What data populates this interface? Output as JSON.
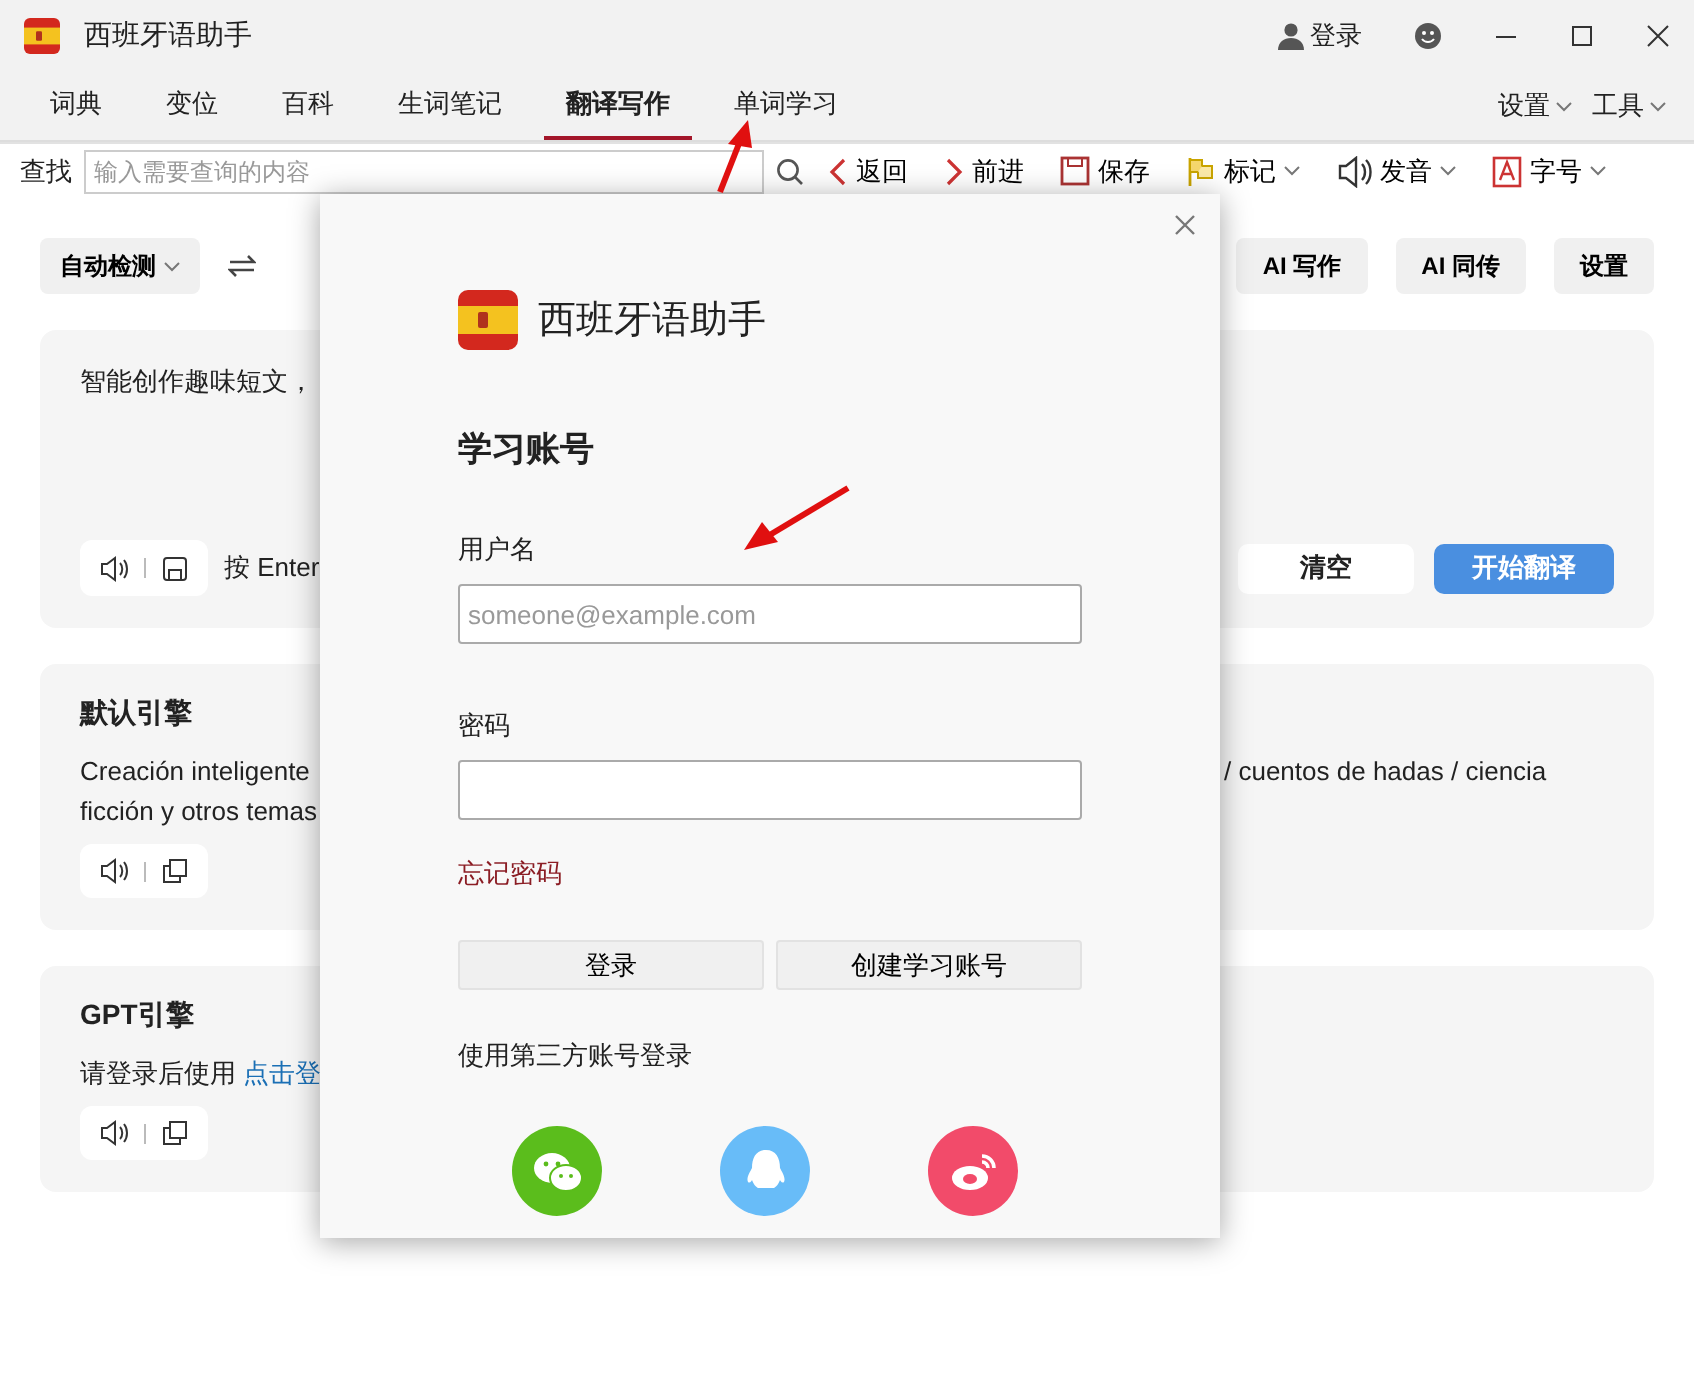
{
  "app": {
    "title": "西班牙语助手",
    "login": "登录"
  },
  "tabs": [
    {
      "label": "词典",
      "selected": false
    },
    {
      "label": "变位",
      "selected": false
    },
    {
      "label": "百科",
      "selected": false
    },
    {
      "label": "生词笔记",
      "selected": false
    },
    {
      "label": "翻译写作",
      "selected": true
    },
    {
      "label": "单词学习",
      "selected": false
    }
  ],
  "menus": [
    "设置",
    "工具"
  ],
  "search": {
    "label": "查找",
    "placeholder": "输入需要查询的内容"
  },
  "toolbar": [
    {
      "label": "返回",
      "kind": "back",
      "dropdown": false
    },
    {
      "label": "前进",
      "kind": "forward",
      "dropdown": false
    },
    {
      "label": "保存",
      "kind": "save",
      "dropdown": false
    },
    {
      "label": "标记",
      "kind": "flag",
      "dropdown": true
    },
    {
      "label": "发音",
      "kind": "speaker",
      "dropdown": true
    },
    {
      "label": "字号",
      "kind": "font",
      "dropdown": true
    }
  ],
  "translate": {
    "source_lang": "自动检测",
    "buttons": [
      "AI 写作",
      "AI 同传",
      "设置"
    ],
    "input_text": "智能创作趣味短文，",
    "hint": "按 Enter",
    "clear": "清空",
    "start": "开始翻译"
  },
  "engines": [
    {
      "title": "默认引擎",
      "left_lines": [
        "Creación inteligente",
        "ficción y otros temas"
      ],
      "right_lines": [
        "/ cuentos de hadas / ciencia"
      ]
    },
    {
      "title": "GPT引擎",
      "left_lines": [
        "请登录后使用"
      ],
      "link": "点击登"
    }
  ],
  "dialog": {
    "app_name": "西班牙语助手",
    "heading": "学习账号",
    "username_label": "用户名",
    "username_placeholder": "someone@example.com",
    "password_label": "密码",
    "forgot": "忘记密码",
    "login": "登录",
    "create": "创建学习账号",
    "third_party": "使用第三方账号登录",
    "providers": [
      {
        "kind": "wechat"
      },
      {
        "kind": "qq"
      },
      {
        "kind": "weibo"
      }
    ]
  }
}
